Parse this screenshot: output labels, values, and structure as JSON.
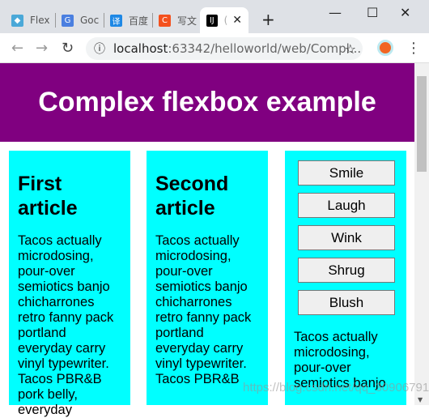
{
  "browser": {
    "tabs": [
      {
        "label": "Flex",
        "color": "#4aa8d8"
      },
      {
        "label": "Goc",
        "color": "#4a7fe0"
      },
      {
        "label": "百度",
        "color": "#1e88e5"
      },
      {
        "label": "写文",
        "color": "#f4511e"
      },
      {
        "label": "(",
        "color": "#000000"
      }
    ],
    "new_tab": "+",
    "url_host": "localhost",
    "url_path": ":63342/helloworld/web/Compl..."
  },
  "page": {
    "title": "Complex flexbox example",
    "articles": [
      {
        "heading": "First article",
        "text": "Tacos actually microdosing, pour-over semiotics banjo chicharrones retro fanny pack portland everyday carry vinyl typewriter. Tacos PBR&B pork belly, everyday"
      },
      {
        "heading": "Second article",
        "text": "Tacos actually microdosing, pour-over semiotics banjo chicharrones retro fanny pack portland everyday carry vinyl typewriter. Tacos PBR&B"
      }
    ],
    "buttons": [
      "Smile",
      "Laugh",
      "Wink",
      "Shrug",
      "Blush"
    ],
    "third_text": "Tacos actually microdosing, pour-over semiotics banjo"
  },
  "watermark": "https://blog.csdn.net/qq_30906791",
  "colors": {
    "header": "#800080",
    "article": "#00ffff"
  }
}
